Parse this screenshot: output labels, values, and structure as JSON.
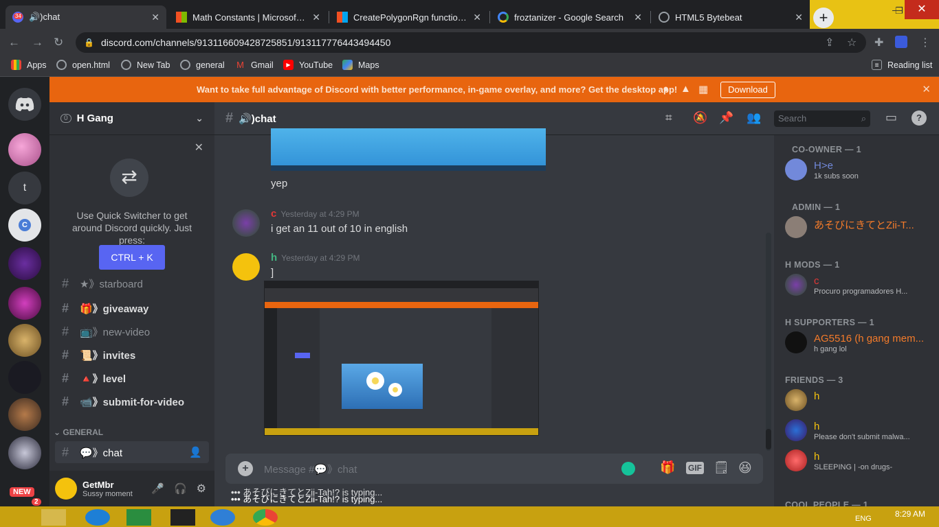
{
  "browser": {
    "tabs": [
      {
        "title": "🔊)chat",
        "badge": "34",
        "active": true
      },
      {
        "title": "Math Constants | Microsoft Doc",
        "active": false
      },
      {
        "title": "CreatePolygonRgn function (win",
        "active": false
      },
      {
        "title": "froztanizer - Google Search",
        "active": false
      },
      {
        "title": "HTML5 Bytebeat",
        "active": false
      }
    ],
    "url": "discord.com/channels/913116609428725851/913117776443494450",
    "bookmarks": [
      "Apps",
      "open.html",
      "New Tab",
      "general",
      "Gmail",
      "YouTube",
      "Maps"
    ],
    "reading_list": "Reading list"
  },
  "banner": {
    "text": "Want to take full advantage of Discord with better performance, in-game overlay, and more? Get the desktop app!",
    "download": "Download"
  },
  "server": {
    "name": "H Gang",
    "badge": "0",
    "quick_switcher": {
      "text": "Use Quick Switcher to get around Discord quickly. Just press:",
      "shortcut": "CTRL + K"
    },
    "channels": [
      {
        "name": "★》starboard",
        "bold": false
      },
      {
        "name": "🎁》giveaway",
        "bold": true
      },
      {
        "name": "📺》new-video",
        "bold": false
      },
      {
        "name": "📜》invites",
        "bold": true
      },
      {
        "name": "🔺》level",
        "bold": true
      },
      {
        "name": "📹》submit-for-video",
        "bold": true
      }
    ],
    "category": "GENERAL",
    "current_channel": "💬》chat",
    "user": {
      "name": "GetMbr",
      "status": "Sussy moment"
    },
    "new_badge": "NEW",
    "new_count": "2"
  },
  "chat": {
    "header": "🔊)chat",
    "search_placeholder": "Search",
    "messages": [
      {
        "author": "",
        "time": "",
        "text": "yep"
      },
      {
        "author": "c",
        "time": "Yesterday at 4:29 PM",
        "text": "i get an 11 out of 10 in english"
      },
      {
        "author": "h",
        "time": "Yesterday at 4:29 PM",
        "text": "]"
      }
    ],
    "composer_placeholder": "Message #💬》chat",
    "gif_label": "GIF",
    "typing": "あそびにきてとZii-Tah!? is typing..."
  },
  "members": {
    "groups": [
      {
        "title": "CO-OWNER — 1",
        "members": [
          {
            "name": "H>e",
            "status": "1k subs soon",
            "color": "#7289da"
          }
        ]
      },
      {
        "title": "ADMIN — 1",
        "members": [
          {
            "name": "あそびにきてとZii-T...",
            "status": "",
            "color": "#f47b2a"
          }
        ]
      },
      {
        "title": "H MODS — 1",
        "members": [
          {
            "name": "c",
            "status": "Procuro programadores H...",
            "color": "#e23737"
          }
        ]
      },
      {
        "title": "H SUPPORTERS — 1",
        "members": [
          {
            "name": "AG5516 (h gang mem...",
            "status": "h gang lol",
            "color": "#f47b2a"
          }
        ]
      },
      {
        "title": "FRIENDS — 3",
        "members": [
          {
            "name": "h",
            "status": "",
            "color": "#f4c20d"
          },
          {
            "name": "h",
            "status": "Please don't submit malwa...",
            "color": "#f4c20d"
          },
          {
            "name": "h",
            "status": "SLEEPING | -on drugs-",
            "color": "#f4c20d"
          }
        ]
      },
      {
        "title": "COOL PEOPLE — 1",
        "members": []
      }
    ]
  },
  "taskbar": {
    "time": "8:29 AM",
    "lang": "ENG"
  },
  "colors": {
    "banner": "#e8650f",
    "blurple": "#5865f2",
    "taskbar": "#c8a110"
  }
}
